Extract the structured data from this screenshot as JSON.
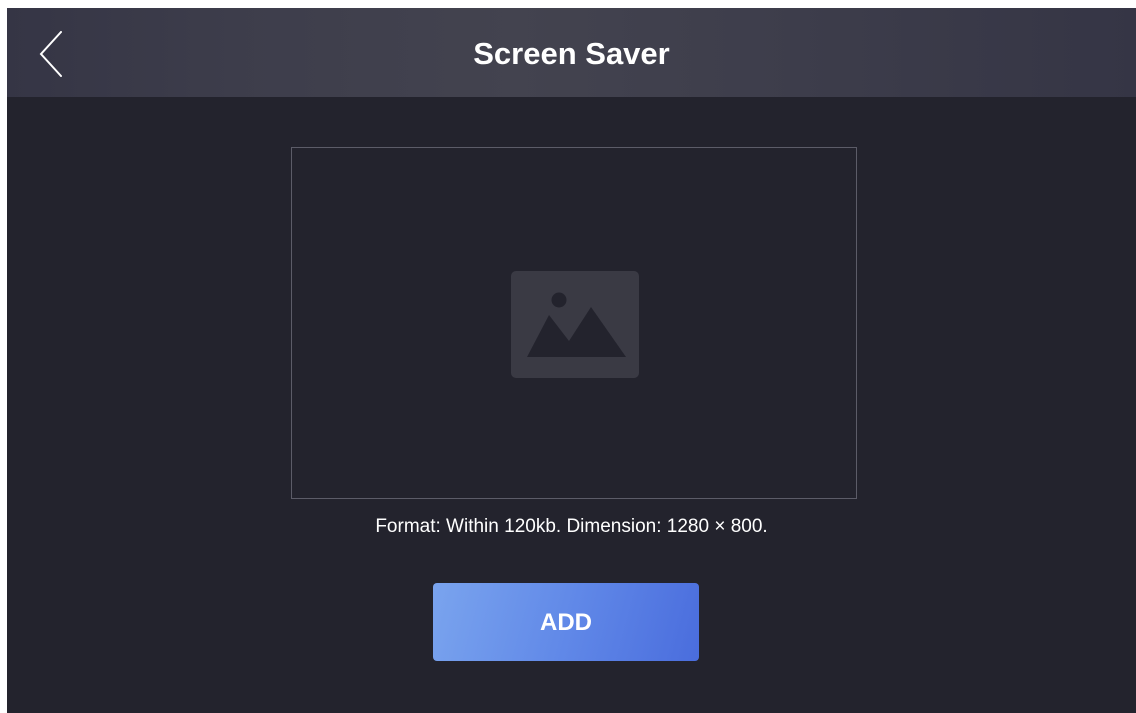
{
  "header": {
    "title": "Screen Saver",
    "back_icon": "chevron-left-icon"
  },
  "preview": {
    "placeholder_icon": "image-placeholder-icon"
  },
  "hint": {
    "text": "Format: Within 120kb. Dimension: 1280 × 800."
  },
  "actions": {
    "add_label": "ADD"
  },
  "colors": {
    "background": "#23232d",
    "header": "#3d3d4b",
    "accent_start": "#7aa4ee",
    "accent_end": "#4a6ddd",
    "text": "#ffffff"
  }
}
